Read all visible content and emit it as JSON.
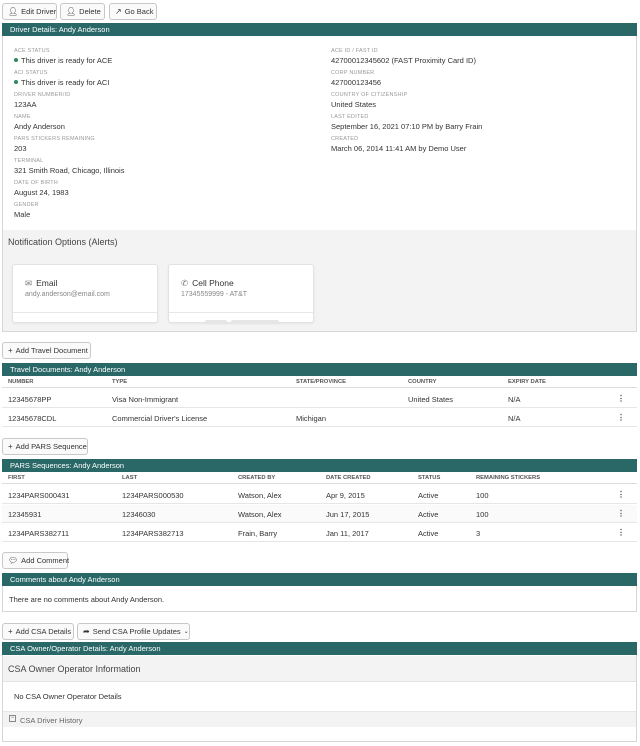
{
  "toolbar": {
    "edit_driver": "Edit Driver",
    "delete": "Delete",
    "go_back": "Go Back"
  },
  "driver_details": {
    "header": "Driver Details: Andy Anderson",
    "left": [
      {
        "label": "ACE STATUS",
        "value": "This driver is ready for ACE",
        "status_dot": true
      },
      {
        "label": "ACI STATUS",
        "value": "This driver is ready for ACI",
        "status_dot": true
      },
      {
        "label": "DRIVER NUMBER/ID",
        "value": "123AA"
      },
      {
        "label": "NAME",
        "value": "Andy Anderson"
      },
      {
        "label": "PARS STICKERS REMAINING",
        "value": "203"
      },
      {
        "label": "TERMINAL",
        "value": "321 Smith Road, Chicago, Illinois"
      },
      {
        "label": "DATE OF BIRTH",
        "value": "August 24, 1983"
      },
      {
        "label": "GENDER",
        "value": "Male"
      }
    ],
    "right": [
      {
        "label": "ACE ID / FAST ID",
        "value": "42700012345602 (FAST Proximity Card ID)"
      },
      {
        "label": "CORP NUMBER",
        "value": "427000123456"
      },
      {
        "label": "COUNTRY OF CITIZENSHIP",
        "value": "United States"
      },
      {
        "label": "LAST EDITED",
        "value": "September 16, 2021 07:10 PM by Barry Frain"
      },
      {
        "label": "CREATED",
        "value": "March 06, 2014 11:41 AM by Demo User"
      }
    ],
    "status_color": "#2c8a5a"
  },
  "notifications": {
    "title": "Notification Options (Alerts)",
    "email": {
      "title": "Email",
      "value": "andy.anderson@email.com",
      "icon": "envelope-icon"
    },
    "phone": {
      "title": "Cell Phone",
      "value": "17345559999 - AT&T",
      "icon": "phone-icon"
    }
  },
  "travel": {
    "add_button": "Add Travel Document",
    "header": "Travel Documents: Andy Anderson",
    "columns": [
      "NUMBER",
      "TYPE",
      "STATE/PROVINCE",
      "COUNTRY",
      "EXPIRY DATE"
    ],
    "rows": [
      [
        "12345678PP",
        "Visa Non-Immigrant",
        "",
        "United States",
        "N/A"
      ],
      [
        "12345678CDL",
        "Commercial Driver's License",
        "Michigan",
        "",
        "N/A"
      ]
    ]
  },
  "pars": {
    "add_button": "Add PARS Sequence",
    "header": "PARS Sequences: Andy Anderson",
    "columns": [
      "FIRST",
      "LAST",
      "CREATED BY",
      "DATE CREATED",
      "STATUS",
      "REMAINING STICKERS"
    ],
    "rows": [
      [
        "1234PARS000431",
        "1234PARS000530",
        "Watson, Alex",
        "Apr 9, 2015",
        "Active",
        "100"
      ],
      [
        "12345931",
        "12346030",
        "Watson, Alex",
        "Jun 17, 2015",
        "Active",
        "100"
      ],
      [
        "1234PARS382711",
        "1234PARS382713",
        "Frain, Barry",
        "Jan 11, 2017",
        "Active",
        "3"
      ]
    ]
  },
  "comments": {
    "add_button": "Add Comment",
    "header": "Comments about Andy Anderson",
    "empty": "There are no comments about Andy Anderson."
  },
  "csa": {
    "add_button": "Add CSA Details",
    "send_button": "Send CSA Profile Updates",
    "header": "CSA Owner/Operator Details: Andy Anderson",
    "section_title": "CSA Owner Operator Information",
    "empty": "No CSA Owner Operator Details",
    "history": "CSA Driver History"
  },
  "colors": {
    "header_bar": "#2a6868"
  }
}
